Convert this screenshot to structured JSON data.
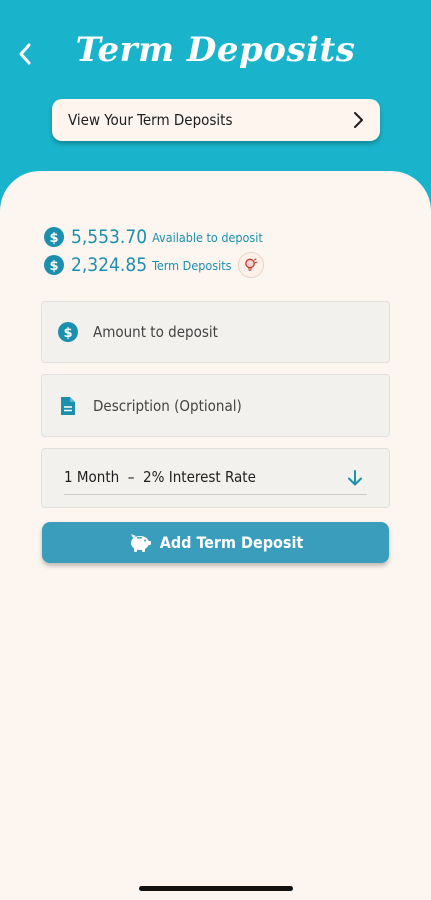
{
  "header": {
    "title": "Term Deposits",
    "back_icon": "chevron-left-icon",
    "view_button_label": "View Your Term Deposits",
    "view_button_icon": "chevron-right-icon"
  },
  "balances": {
    "available_amount": "5,553.70",
    "available_label": "Available to deposit",
    "term_amount": "2,324.85",
    "term_label": "Term Deposits",
    "coin_icon": "dollar-coin-icon",
    "help_icon": "lightbulb-help-icon"
  },
  "form": {
    "amount_placeholder": "Amount to deposit",
    "description_placeholder": "Description (Optional)",
    "term_selected": "1 Month  –  2% Interest Rate",
    "submit_label": "Add Term Deposit"
  },
  "colors": {
    "header_bg": "#19b4cb",
    "accent": "#1c8fae",
    "button_bg": "#3a9dbc",
    "sheet_bg": "#fdf6f0"
  }
}
